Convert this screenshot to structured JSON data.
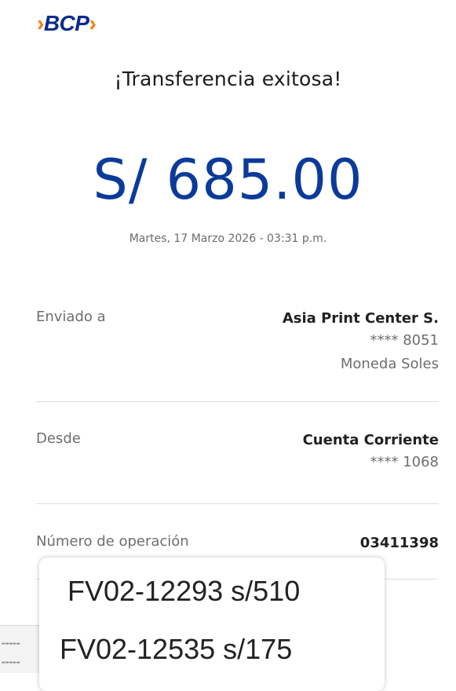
{
  "brand": {
    "logo_text": "BCP",
    "chev_left": "›",
    "chev_right": "›",
    "color": "#0a2a8f",
    "accent": "#ff7a00"
  },
  "header": {
    "title": "¡Transferencia exitosa!"
  },
  "transfer": {
    "amount": "S/ 685.00",
    "datetime": "Martes, 17 Marzo 2026 - 03:31 p.m."
  },
  "details": {
    "sent_to": {
      "label": "Enviado a",
      "name": "Asia Print Center S.",
      "account": "**** 8051",
      "currency": "Moneda Soles"
    },
    "from": {
      "label": "Desde",
      "name": "Cuenta Corriente",
      "account": "**** 1068"
    },
    "operation": {
      "label": "Número de operación",
      "number": "03411398"
    }
  },
  "overlay_note": {
    "line1": "FV02-12293 s/510",
    "line2": "FV02-12535  s/175"
  }
}
